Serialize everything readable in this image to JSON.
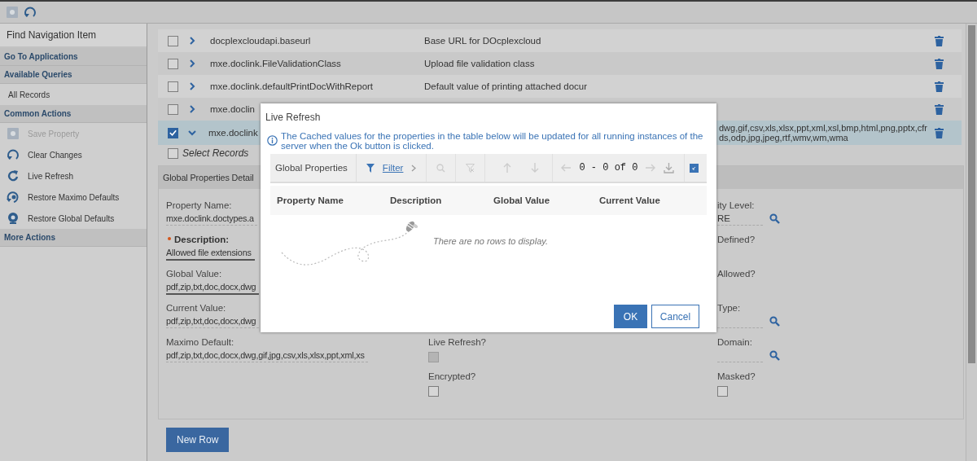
{
  "toolbar": [
    {
      "kind": "save",
      "disabled": true
    },
    {
      "kind": "undo",
      "disabled": false
    }
  ],
  "sidebar": {
    "search_label": "Find Navigation Item",
    "sections": [
      {
        "title": "Go To Applications"
      },
      {
        "title": "Available Queries",
        "items": [
          {
            "label": "All Records",
            "kind": "plain",
            "disabled": false
          }
        ]
      },
      {
        "title": "Common Actions",
        "items": [
          {
            "label": "Save Property",
            "kind": "save",
            "disabled": true
          },
          {
            "label": "Clear Changes",
            "kind": "undo",
            "disabled": false
          },
          {
            "label": "Live Refresh",
            "kind": "refresh",
            "disabled": false
          },
          {
            "label": "Restore Maximo Defaults",
            "kind": "restore-maximo",
            "disabled": false
          },
          {
            "label": "Restore Global Defaults",
            "kind": "restore-global",
            "disabled": false
          }
        ]
      },
      {
        "title": "More Actions"
      }
    ]
  },
  "table": {
    "rows": [
      {
        "name": "docplexcloudapi.baseurl",
        "description": "Base URL for DOcplexcloud",
        "checked": false,
        "expanded": false,
        "selected": false
      },
      {
        "name": "mxe.doclink.FileValidationClass",
        "description": "Upload file validation class",
        "checked": false,
        "expanded": false,
        "selected": false
      },
      {
        "name": "mxe.doclink.defaultPrintDocWithReport",
        "description": "Default value of printing attached docur",
        "checked": false,
        "expanded": false,
        "selected": false
      },
      {
        "name": "mxe.doclin",
        "checked": false,
        "expanded": false,
        "selected": false
      },
      {
        "name": "mxe.doclink",
        "description_lines": [
          "dwg,gif,csv,xls,xlsx,ppt,xml,xsl,bmp,html,png,pptx,cfr",
          "ds,odp,jpg,jpeg,rtf,wmv,wm,wma"
        ],
        "checked": true,
        "expanded": true,
        "selected": true
      }
    ],
    "select_all": {
      "label": "Select Records",
      "checked": false
    }
  },
  "details": {
    "title": "Global Properties Detail",
    "left": [
      {
        "label": "Property Name:",
        "value": "mxe.doclink.doctypes.a",
        "editable": false,
        "required": false
      },
      {
        "label": "Description:",
        "value": "Allowed file extensions",
        "editable": true,
        "required": true
      },
      {
        "label": "Global Value:",
        "value": "pdf,zip,txt,doc,docx,dwg",
        "editable": true,
        "required": false
      },
      {
        "label": "Current Value:",
        "value": "pdf,zip,txt,doc,docx,dwg",
        "editable": false,
        "required": false
      },
      {
        "label": "Maximo Default:",
        "value": "pdf,zip,txt,doc,docx,dwg,gif,jpg,csv,xls,xlsx,ppt,xml,xs",
        "editable": false,
        "required": false
      }
    ],
    "middle": [
      {
        "label": "Live Refresh?",
        "kind": "checkbox",
        "checked": false,
        "disabled": true
      },
      {
        "label": "Encrypted?",
        "kind": "checkbox",
        "checked": false,
        "disabled": false
      }
    ],
    "right": [
      {
        "label": "ity Level:",
        "kind": "lookup",
        "value": "RE"
      },
      {
        "label": "Defined?",
        "kind": "label"
      },
      {
        "label": "Allowed?",
        "kind": "label"
      },
      {
        "label": "Type:",
        "kind": "lookup"
      },
      {
        "label": "Domain:",
        "kind": "lookup"
      },
      {
        "label": "Masked?",
        "kind": "checkbox",
        "checked": false,
        "disabled": false
      }
    ],
    "new_row_button": "New Row"
  },
  "dialog": {
    "title": "Live Refresh",
    "message": "The Cached values for the properties in the table below will be updated for all running instances of the server when the Ok button is clicked.",
    "table": {
      "title": "Global Properties",
      "filter_label": "Filter",
      "page_info": "0 - 0 of 0",
      "columns": [
        "Property Name",
        "Description",
        "Global Value",
        "Current Value"
      ],
      "empty_message": "There are no rows to display."
    },
    "buttons": [
      {
        "label": "OK",
        "kind": "primary"
      },
      {
        "label": "Cancel",
        "kind": "secondary"
      }
    ]
  }
}
